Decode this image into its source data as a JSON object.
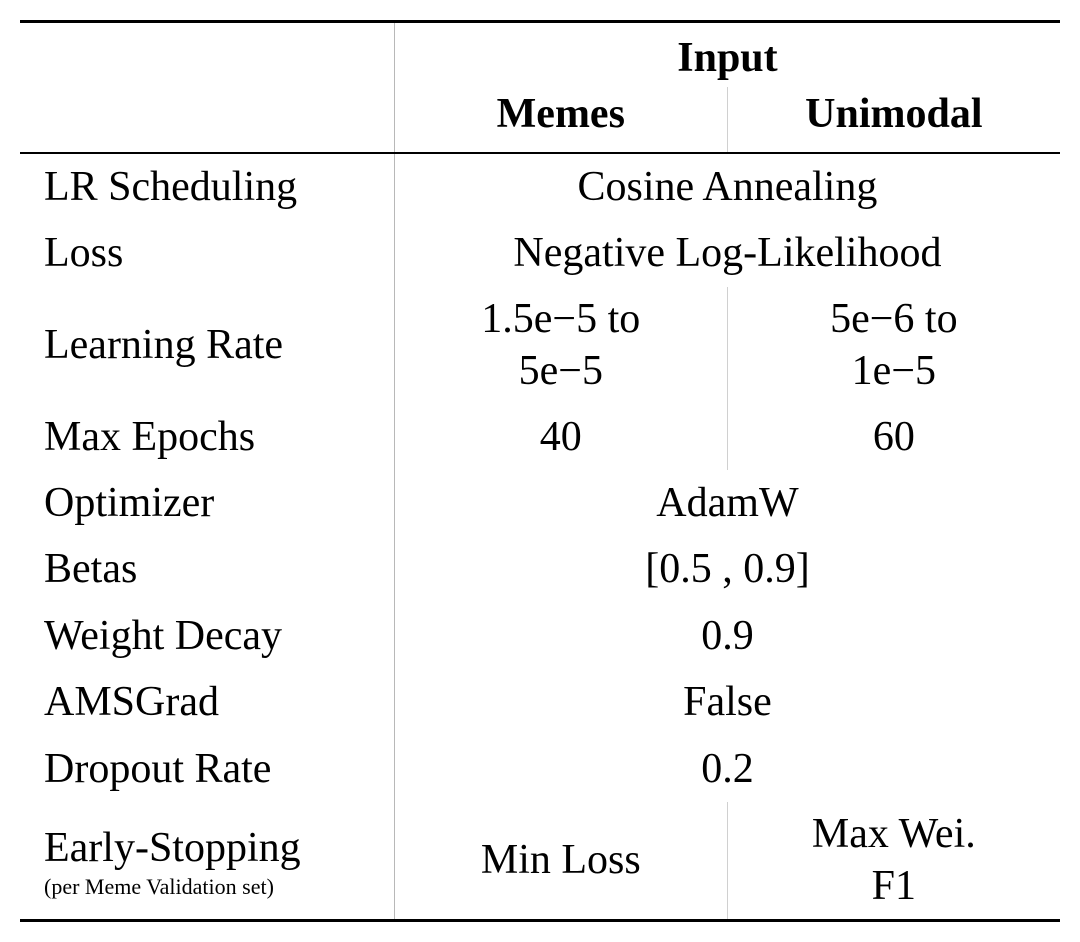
{
  "header": {
    "group": "Input",
    "col1": "Memes",
    "col2": "Unimodal"
  },
  "rows": {
    "lr_sched": {
      "label": "LR Scheduling",
      "value": "Cosine Annealing"
    },
    "loss": {
      "label": "Loss",
      "value": "Negative Log-Likelihood"
    },
    "learning_rate": {
      "label": "Learning Rate",
      "memes_l1": "1.5e−5 to",
      "memes_l2": "5e−5",
      "unimodal_l1": "5e−6 to",
      "unimodal_l2": "1e−5"
    },
    "max_epochs": {
      "label": "Max Epochs",
      "memes": "40",
      "unimodal": "60"
    },
    "optimizer": {
      "label": "Optimizer",
      "value": "AdamW"
    },
    "betas": {
      "label": "Betas",
      "value": "[0.5 , 0.9]"
    },
    "weight_decay": {
      "label": "Weight Decay",
      "value": "0.9"
    },
    "amsgrad": {
      "label": "AMSGrad",
      "value": "False"
    },
    "dropout": {
      "label": "Dropout Rate",
      "value": "0.2"
    },
    "early_stopping": {
      "label_main": "Early-Stopping",
      "label_sub": "(per Meme Validation set)",
      "memes": "Min Loss",
      "unimodal_l1": "Max Wei.",
      "unimodal_l2": "F1"
    }
  }
}
